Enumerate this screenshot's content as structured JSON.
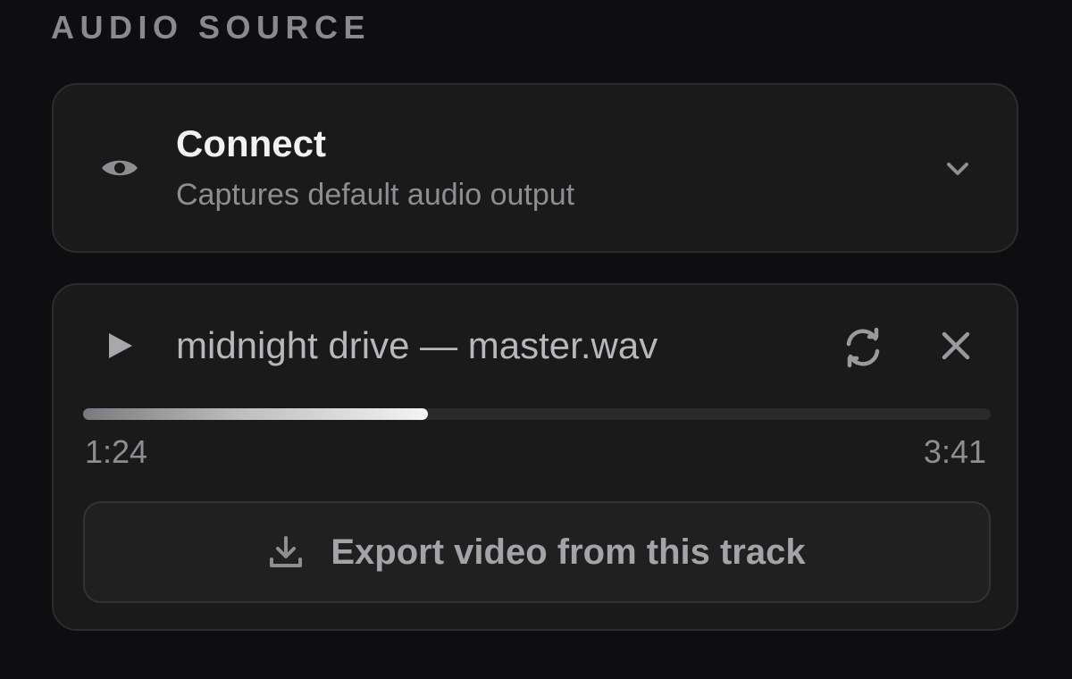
{
  "section": {
    "title": "AUDIO SOURCE"
  },
  "source": {
    "title": "Connect",
    "subtitle": "Captures default audio output",
    "icon": "eye-icon",
    "expand_icon": "chevron-down-icon"
  },
  "track": {
    "name": "midnight drive — master.wav",
    "play_icon": "play-icon",
    "replace_icon": "refresh-icon",
    "remove_icon": "close-icon",
    "progress_fraction": 0.38,
    "elapsed": "1:24",
    "duration": "3:41",
    "export_label": "Export video from this track",
    "export_icon": "download-icon"
  },
  "colors": {
    "background": "#0e0e10",
    "card": "#1a1a1b",
    "border": "#2c2c2e",
    "text_primary": "#f2f2f3",
    "text_secondary": "#8e8e92"
  }
}
